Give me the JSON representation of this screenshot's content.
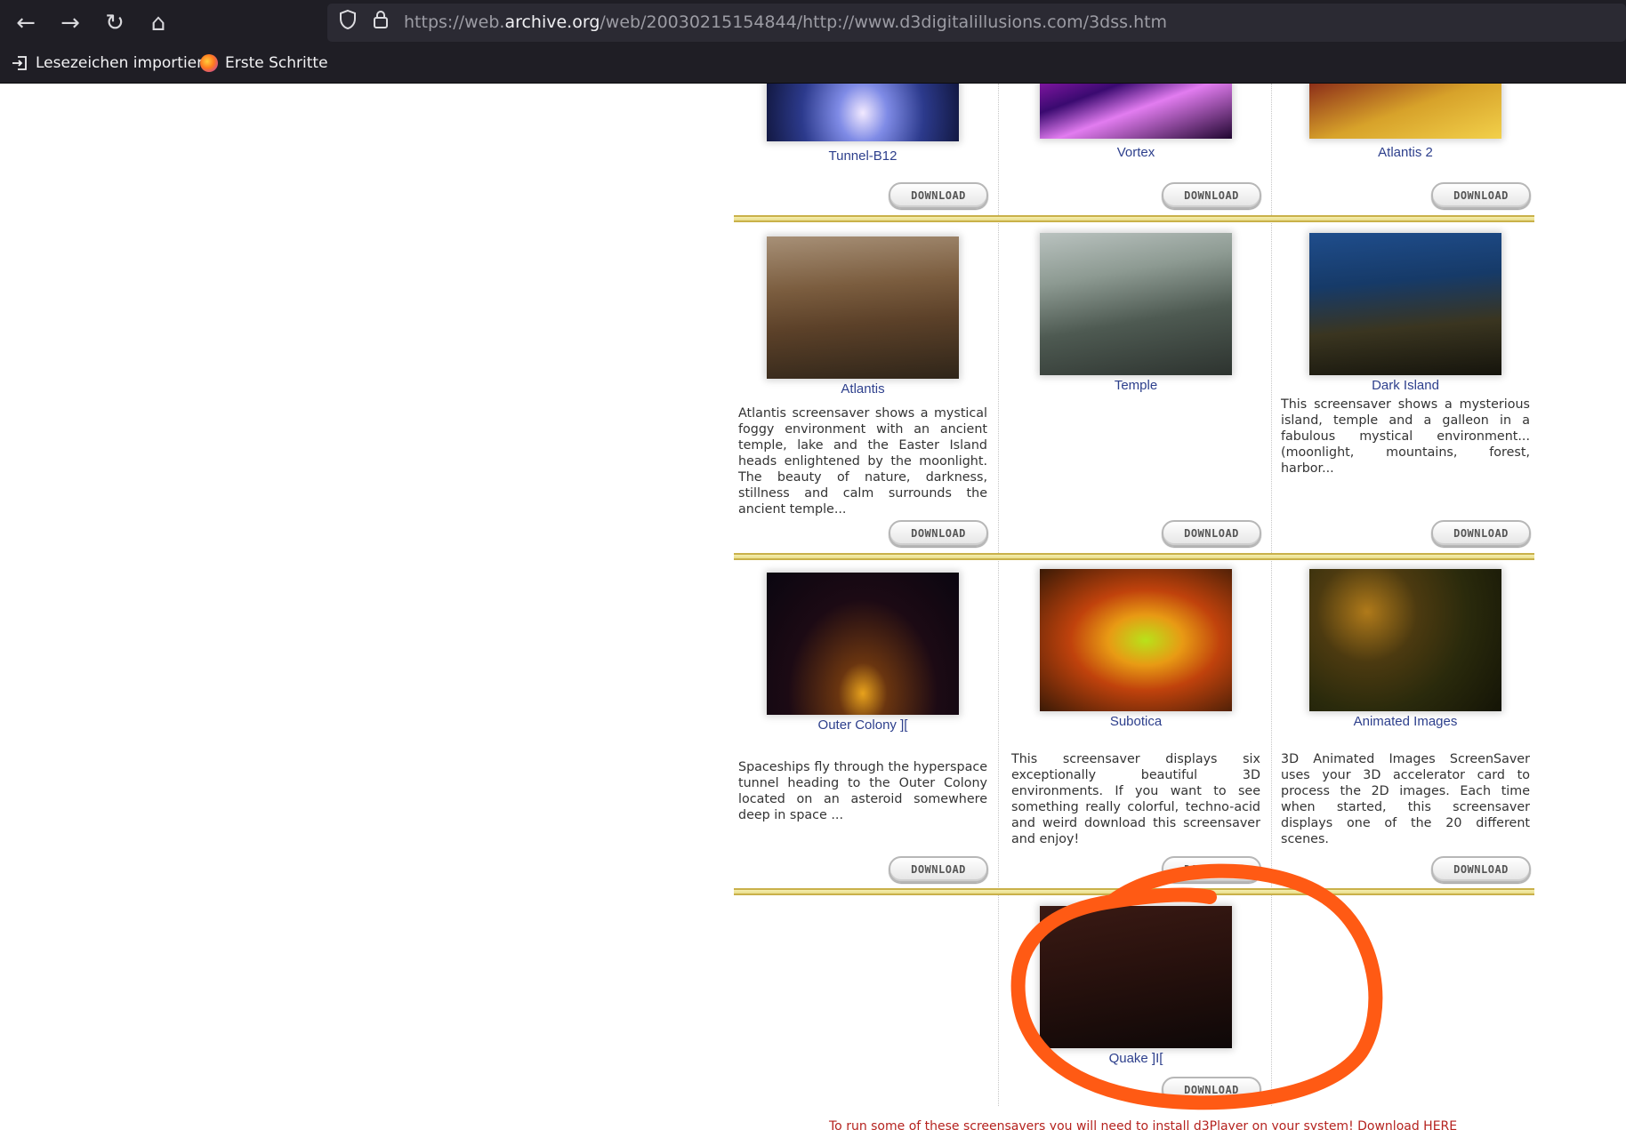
{
  "browser": {
    "url_prefix": "https://web.",
    "url_domain": "archive.org",
    "url_path": "/web/20030215154844/http://www.d3digitalillusions.com/3dss.htm",
    "back_icon": "arrow-left-icon",
    "forward_icon": "arrow-right-icon",
    "reload_icon": "reload-icon",
    "home_icon": "home-icon",
    "bookmarks": [
      {
        "label": "Lesezeichen importier...",
        "icon": "import-icon"
      },
      {
        "label": "Erste Schritte",
        "icon": "firefox-icon"
      }
    ]
  },
  "colors": {
    "caption": "#2d3f8c",
    "separator": "#c9b14a",
    "annotation": "#ff5a14",
    "footer_note": "#b5231f"
  },
  "items": [
    {
      "caption": "Tunnel-B12",
      "button": "DOWNLOAD"
    },
    {
      "caption": "Vortex",
      "button": "DOWNLOAD"
    },
    {
      "caption": "Atlantis 2",
      "button": "DOWNLOAD"
    },
    {
      "caption": "Atlantis",
      "button": "DOWNLOAD",
      "description": "Atlantis screensaver shows a mystical foggy environment with an ancient temple, lake and the Easter Island heads enlightened by the moonlight. The beauty of nature, darkness, stillness and calm surrounds the ancient temple..."
    },
    {
      "caption": "Temple",
      "button": "DOWNLOAD"
    },
    {
      "caption": "Dark Island",
      "button": "DOWNLOAD",
      "description": "This screensaver shows a mysterious island, temple and a galleon in a fabulous mystical environment... (moonlight, mountains, forest, harbor..."
    },
    {
      "caption": "Outer Colony ][",
      "button": "DOWNLOAD",
      "description": "Spaceships fly through the hyperspace tunnel heading to the Outer Colony located on an asteroid somewhere deep in space ..."
    },
    {
      "caption": "Subotica",
      "button": "DOWNLOAD",
      "description": "This screensaver displays six exceptionally beautiful 3D environments. If you want to see something really colorful, techno-acid and weird download this screensaver and enjoy!"
    },
    {
      "caption": "Animated Images",
      "button": "DOWNLOAD",
      "description": "3D Animated Images ScreenSaver uses your 3D accelerator card to process the 2D images. Each time when started, this screensaver displays one of the 20 different scenes."
    },
    {
      "caption": "Quake ]I[",
      "button": "DOWNLOAD"
    }
  ],
  "footer_note": "To run some of these screensavers you will need to install d3Player on your system! Download HERE"
}
